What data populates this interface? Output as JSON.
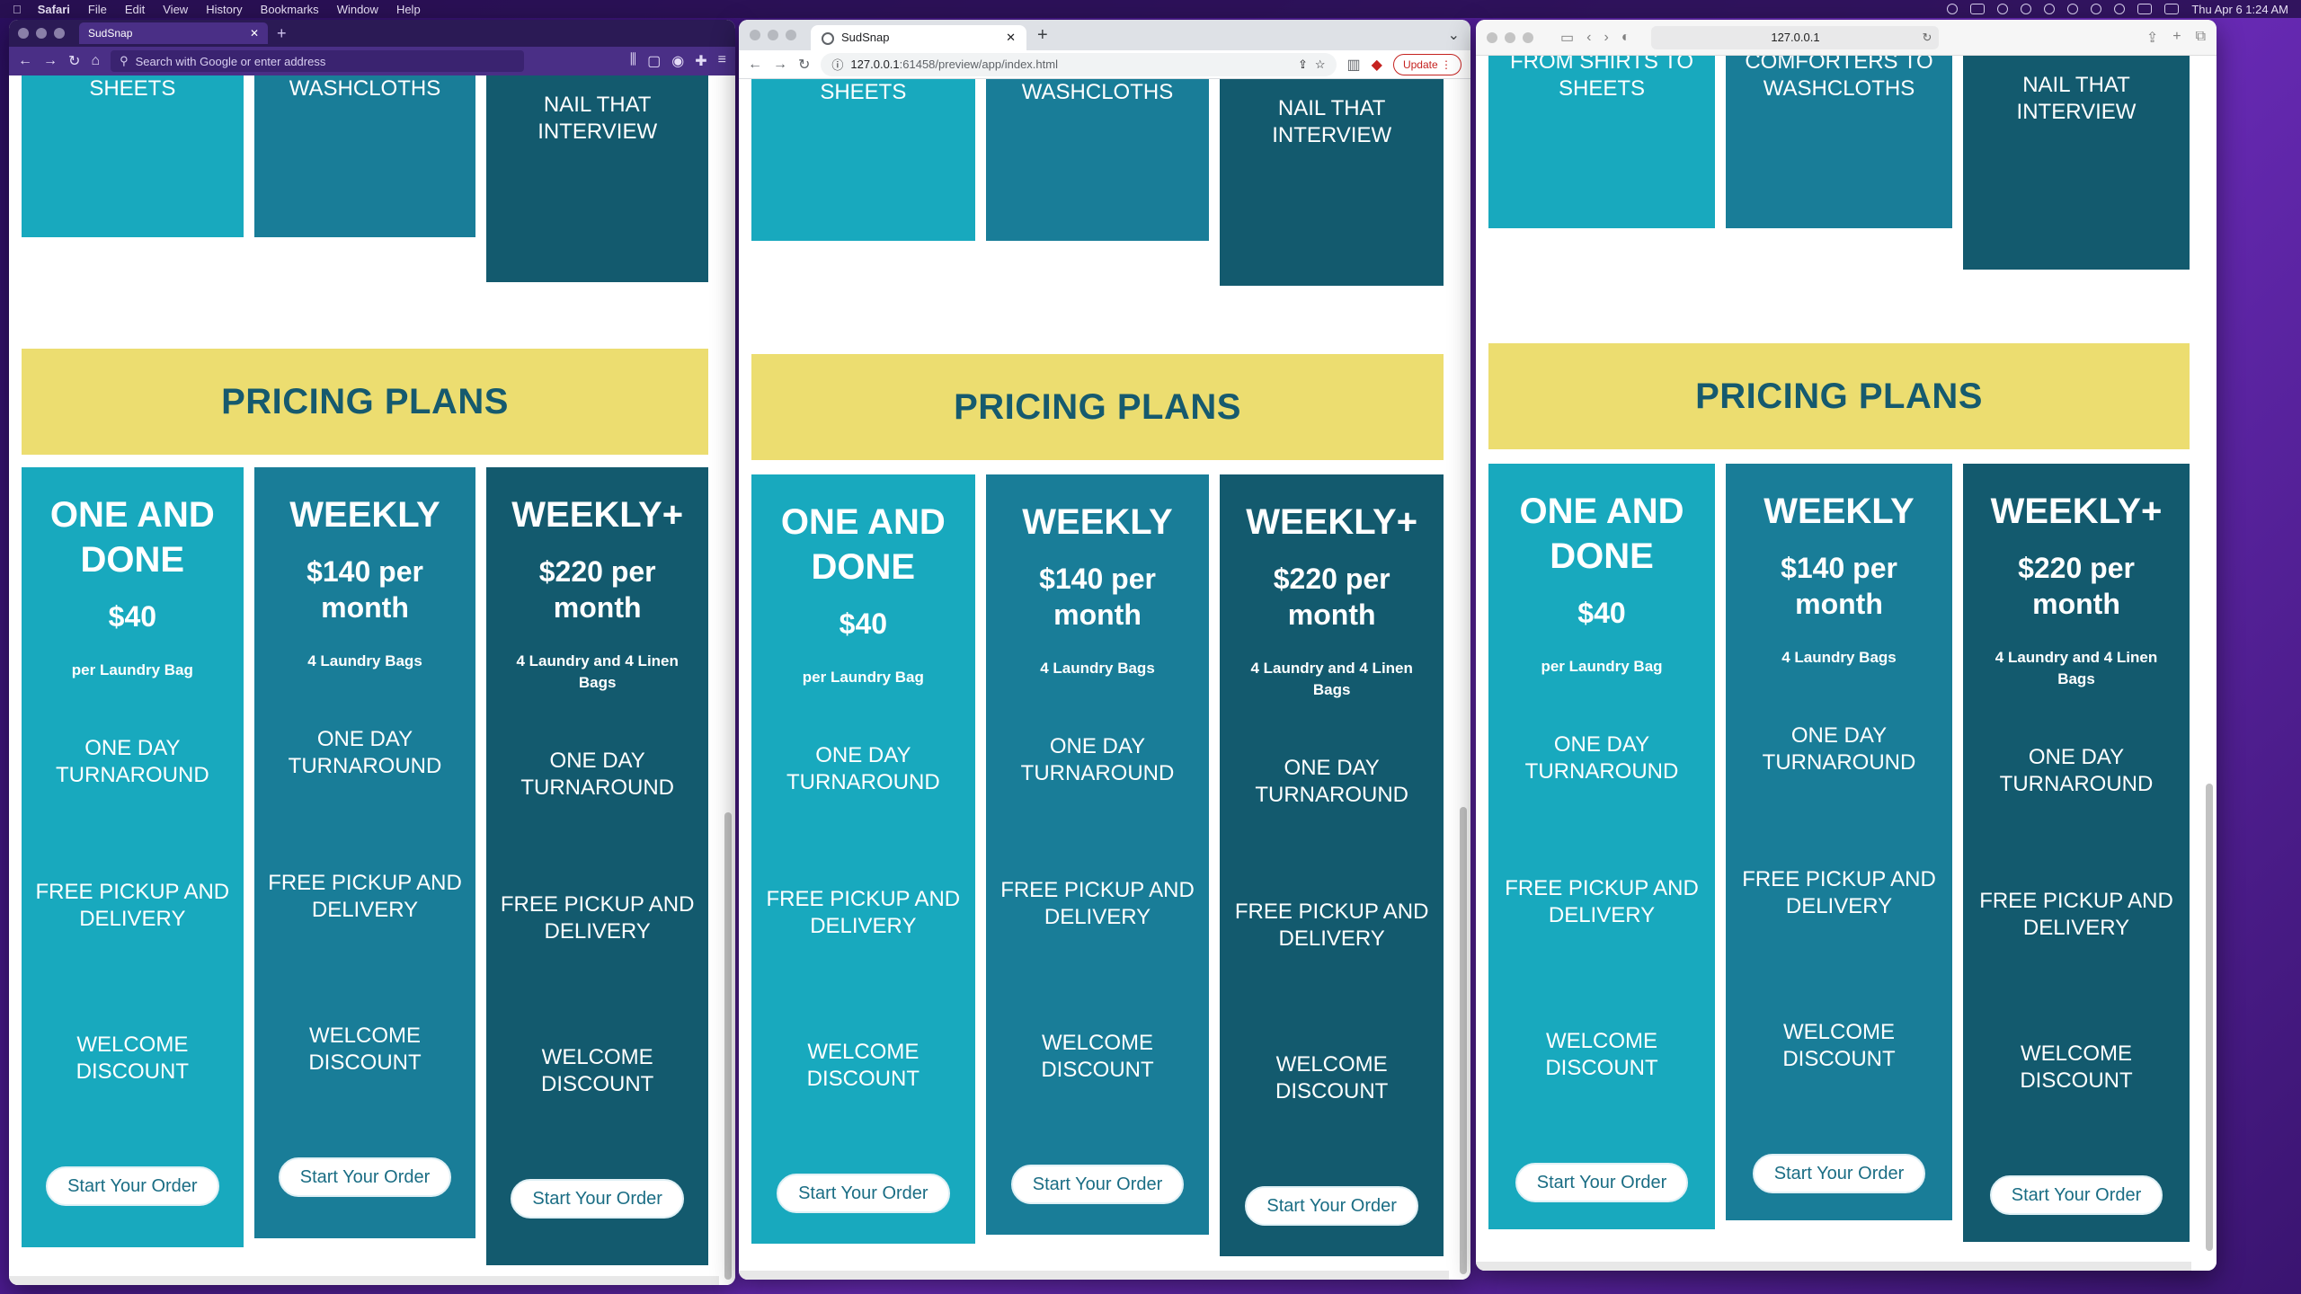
{
  "menubar": {
    "app": "Safari",
    "items": [
      "File",
      "Edit",
      "View",
      "History",
      "Bookmarks",
      "Window",
      "Help"
    ],
    "clock": "Thu Apr 6  1:24 AM"
  },
  "firefox": {
    "tab_title": "SudSnap",
    "url_placeholder": "Search with Google or enter address"
  },
  "chrome": {
    "tab_title": "SudSnap",
    "url_host": "127.0.0.1",
    "url_rest": ":61458/preview/app/index.html",
    "update_label": "Update"
  },
  "safari": {
    "url": "127.0.0.1"
  },
  "services": {
    "col1": "SHEETS",
    "col2": "WASHCLOTHS",
    "col3": "NAIL THAT INTERVIEW",
    "col1_safari": "FROM SHIRTS TO SHEETS",
    "col2_safari": "COMFORTERS TO WASHCLOTHS"
  },
  "pricing": {
    "heading": "PRICING PLANS",
    "plans": [
      {
        "name": "ONE AND DONE",
        "price": "$40",
        "desc": "per Laundry Bag",
        "feature1": "ONE DAY TURNAROUND",
        "feature2": "FREE PICKUP AND DELIVERY",
        "feature3": "WELCOME DISCOUNT",
        "cta": "Start Your Order"
      },
      {
        "name": "WEEKLY",
        "price": "$140 per month",
        "desc": "4 Laundry Bags",
        "feature1": "ONE DAY TURNAROUND",
        "feature2": "FREE PICKUP AND DELIVERY",
        "feature3": "WELCOME DISCOUNT",
        "cta": "Start Your Order"
      },
      {
        "name": "WEEKLY+",
        "price": "$220 per month",
        "desc": "4 Laundry and 4 Linen Bags",
        "feature1": "ONE DAY TURNAROUND",
        "feature2": "FREE PICKUP AND DELIVERY",
        "feature3": "WELCOME DISCOUNT",
        "cta": "Start Your Order"
      }
    ]
  },
  "colors": {
    "plan1": "#18a9be",
    "plan2": "#197d98",
    "plan3": "#135a6e",
    "banner": "#ecdd70",
    "heading": "#165a6e"
  }
}
